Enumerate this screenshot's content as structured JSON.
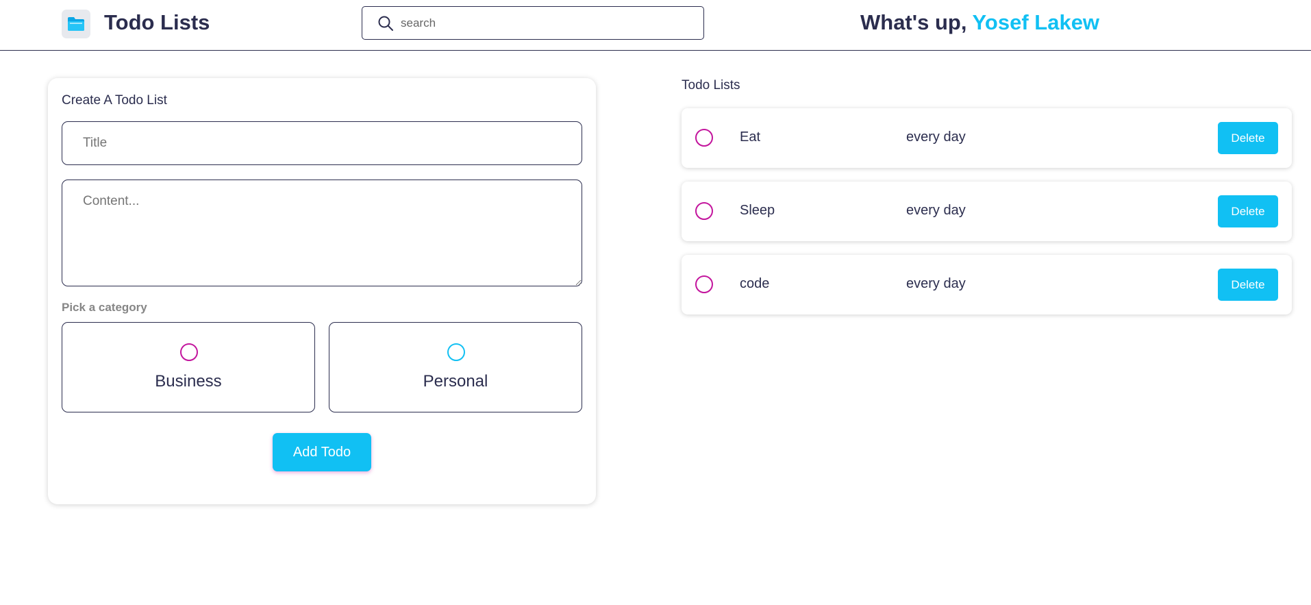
{
  "header": {
    "app_title": "Todo Lists",
    "logo_icon": "folder-icon",
    "search_placeholder": "search",
    "greeting_prefix": "What's up,",
    "user_name": "Yosef Lakew"
  },
  "create_form": {
    "title": "Create A Todo List",
    "title_placeholder": "Title",
    "content_placeholder": "Content...",
    "category_label": "Pick a category",
    "categories": [
      {
        "label": "Business",
        "color": "#c3159d"
      },
      {
        "label": "Personal",
        "color": "#11c0f3"
      }
    ],
    "submit_label": "Add Todo"
  },
  "todo_list": {
    "title": "Todo Lists",
    "items": [
      {
        "name": "Eat",
        "content": "every day",
        "delete_label": "Delete"
      },
      {
        "name": "Sleep",
        "content": "every day",
        "delete_label": "Delete"
      },
      {
        "name": "code",
        "content": "every day",
        "delete_label": "Delete"
      }
    ]
  },
  "colors": {
    "accent": "#11c0f3",
    "business": "#c3159d",
    "text": "#2b2d4e"
  }
}
